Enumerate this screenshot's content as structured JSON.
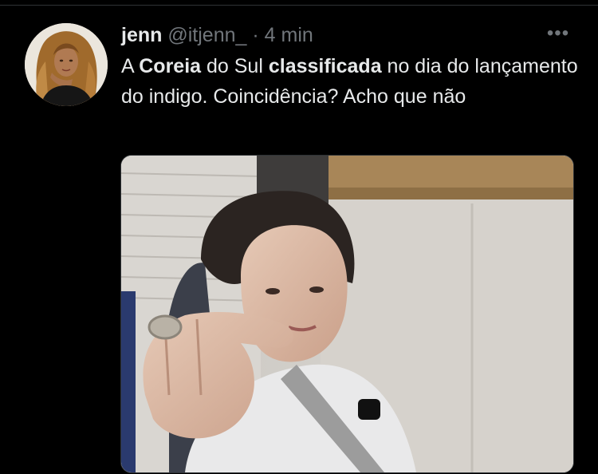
{
  "tweet": {
    "author_name": "jenn",
    "handle": "@itjenn_",
    "separator": "·",
    "time": "4 min",
    "more_icon": "more-horizontal-icon",
    "text": {
      "p1": "A ",
      "b1": "Coreia",
      "p2": " do Sul ",
      "b2": "classificada",
      "p3": " no dia do lançamento do indigo. Coincidência? Acho que não"
    }
  },
  "colors": {
    "background": "#000000",
    "text_primary": "#e7e9ea",
    "text_secondary": "#71767b",
    "divider": "#2f3336"
  }
}
